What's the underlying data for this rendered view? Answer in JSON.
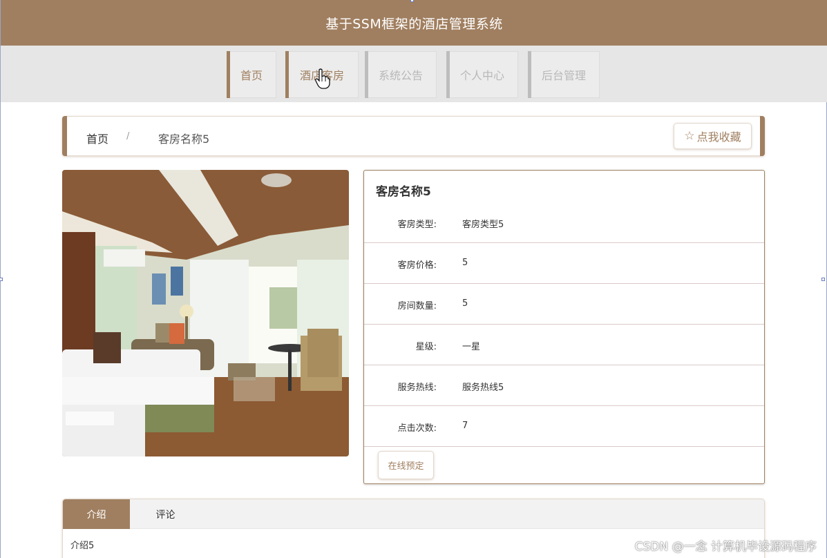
{
  "header": {
    "title": "基于SSM框架的酒店管理系统"
  },
  "nav": {
    "items": [
      {
        "label": "首页",
        "state": "active"
      },
      {
        "label": "酒店客房",
        "state": "active"
      },
      {
        "label": "系统公告",
        "state": "inactive"
      },
      {
        "label": "个人中心",
        "state": "inactive"
      },
      {
        "label": "后台管理",
        "state": "inactive"
      }
    ]
  },
  "breadcrumb": {
    "home": "首页",
    "separator": "/",
    "current": "客房名称5"
  },
  "favorite": {
    "icon": "star-icon",
    "label": "点我收藏"
  },
  "room": {
    "image_alt": "hotel-room-photo",
    "name": "客房名称5",
    "fields": [
      {
        "label": "客房类型:",
        "value": "客房类型5"
      },
      {
        "label": "客房价格:",
        "value": "5"
      },
      {
        "label": "房间数量:",
        "value": "5"
      },
      {
        "label": "星级:",
        "value": "一星"
      },
      {
        "label": "服务热线:",
        "value": "服务热线5"
      },
      {
        "label": "点击次数:",
        "value": "7"
      }
    ],
    "book_label": "在线预定"
  },
  "tabs": {
    "items": [
      {
        "label": "介绍"
      },
      {
        "label": "评论"
      }
    ],
    "content": "介绍5"
  },
  "watermark": "CSDN @一念 计算机毕设源码程序",
  "colors": {
    "brand": "#a07f60",
    "nav_bg": "#e6e6e6",
    "inactive": "#bdbdbd"
  }
}
